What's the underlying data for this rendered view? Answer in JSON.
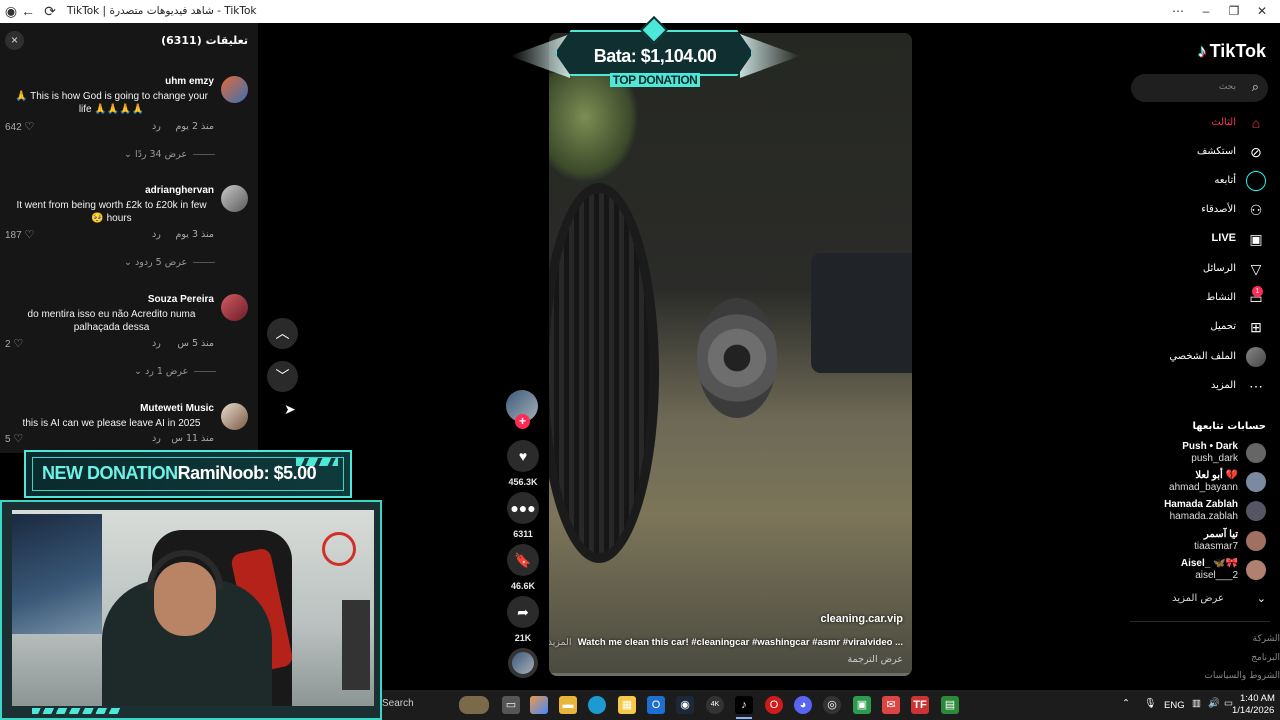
{
  "browser": {
    "title": "TikTok | شاهد فيديوهات متصدرة - TikTok",
    "icons": [
      "tiktok-tab-icon",
      "back-icon",
      "reload-icon"
    ],
    "window_controls": [
      "more-icon",
      "minimize-icon",
      "restore-icon",
      "close-icon"
    ]
  },
  "comments": {
    "header": "تعليقات (6311)",
    "close": "×",
    "items": [
      {
        "user": "uhm emzy",
        "text": "🙏 This is how God is going to change your life 🙏🙏🙏🙏",
        "time": "منذ 2 يوم",
        "reply": "رد",
        "likes": "642",
        "more": "عرض 34 ردًا",
        "avatar_color": "#3b6fb5"
      },
      {
        "user": "adrianghervan",
        "text": "It went from being worth £2k to £20k in few 🥺 hours",
        "time": "منذ 3 يوم",
        "reply": "رد",
        "likes": "187",
        "more": "عرض 5 ردود",
        "avatar_color": "#8a8a8a"
      },
      {
        "user": "Souza Pereira",
        "text": "do mentira isso eu não Acredito numa palhaçada dessa",
        "time": "منذ 5 س",
        "reply": "رد",
        "likes": "2",
        "more": "عرض 1 رد",
        "avatar_color": "#b13a45"
      },
      {
        "user": "Muteweti Music",
        "text": "this is AI can we please leave AI in 2025",
        "time": "منذ 11 س",
        "reply": "رد",
        "likes": "5",
        "avatar_color": "#c9b8a6"
      }
    ]
  },
  "overlay": {
    "new_donation_label": "NEW DONATION",
    "new_donation_text": "RamiNoob: $5.00",
    "top_donation_amount": "Bata: $1,104.00",
    "top_donation_label": "TOP DONATION",
    "accent": "#4ee8d8"
  },
  "video": {
    "author": "cleaning.car.vip",
    "caption": "Watch me clean this car! #cleaningcar #washingcar #asmr #viralvideo ...",
    "more": "المزيد",
    "translate": "عرض الترجمة",
    "progress": 0.0
  },
  "actions": {
    "likes": "456.3K",
    "comments": "6311",
    "saves": "46.6K",
    "shares": "21K",
    "follow_plus": "+"
  },
  "sidebar": {
    "logo": "TikTok",
    "search_placeholder": "بحث",
    "nav": [
      {
        "label": "الثالث",
        "icon": "home-icon",
        "active": true
      },
      {
        "label": "استكشف",
        "icon": "compass-icon"
      },
      {
        "label": "أتابعه",
        "icon": "following-icon"
      },
      {
        "label": "الأصدقاء",
        "icon": "friends-icon"
      },
      {
        "label": "LIVE",
        "icon": "live-icon"
      },
      {
        "label": "الرسائل",
        "icon": "messages-icon"
      },
      {
        "label": "النشاط",
        "icon": "activity-icon"
      },
      {
        "label": "تحميل",
        "icon": "upload-icon"
      },
      {
        "label": "الملف الشخصي",
        "icon": "profile-icon"
      },
      {
        "label": "المزيد",
        "icon": "more-icon"
      }
    ],
    "activity_badge": "1",
    "following_header": "حسابات تتابعها",
    "following": [
      {
        "name": "Push • Dark",
        "handle": "push_dark",
        "color": "#666"
      },
      {
        "name": "أبو لعلا 💔",
        "handle": "ahmad_bayann",
        "color": "#7b8aa0"
      },
      {
        "name": "Hamada Zablah",
        "handle": "hamada.zablah",
        "color": "#556"
      },
      {
        "name": "تيا آسمر",
        "handle": "tiaasmar7",
        "color": "#a07060"
      },
      {
        "name": "Aisel_ 🦋🎀",
        "handle": "aisel___2",
        "color": "#b08070"
      }
    ],
    "show_more": "عرض المزيد",
    "footer": [
      "الشركة",
      "البرنامج",
      "الشروط والسياسات"
    ]
  },
  "taskbar": {
    "search": "Search",
    "lang": "ENG",
    "time": "1:40 AM",
    "date": "1/14/2026"
  }
}
